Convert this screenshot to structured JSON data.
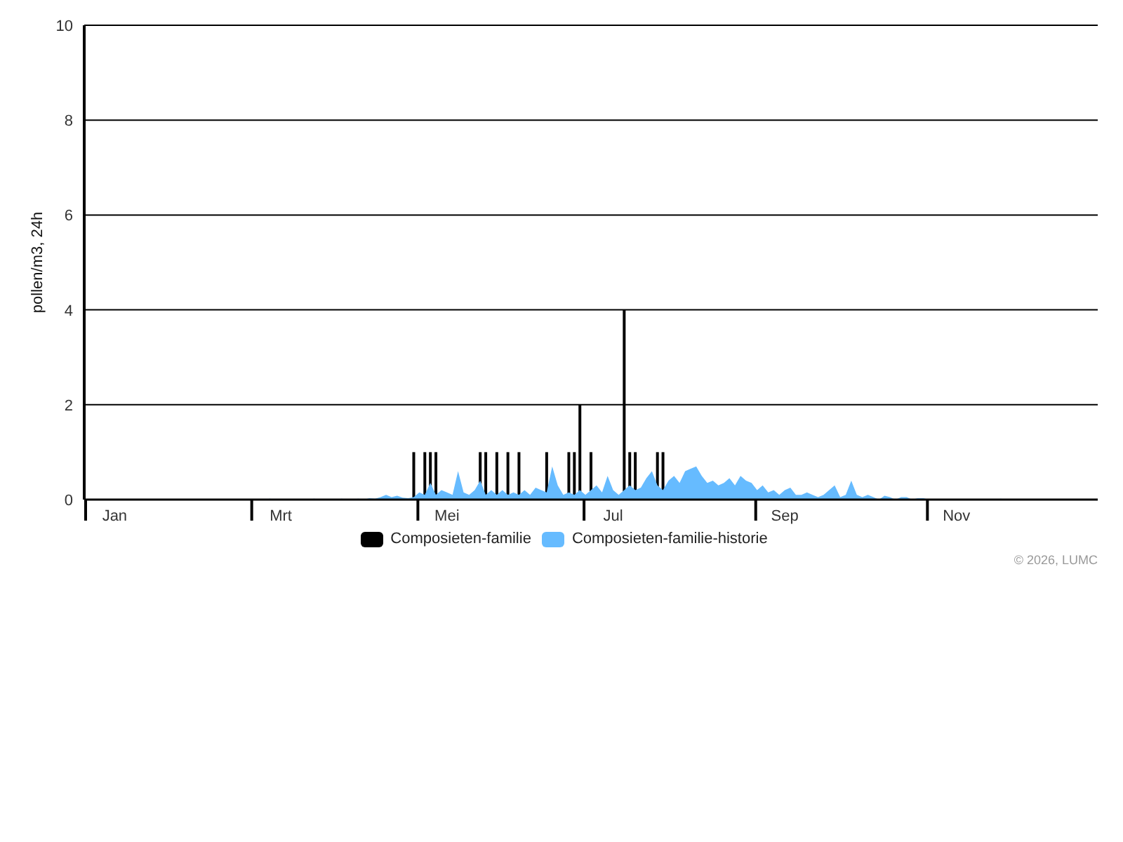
{
  "chart_data": {
    "type": "area",
    "ylabel": "pollen/m3, 24h",
    "categories": [
      null,
      null,
      null,
      null,
      null,
      "Jan",
      null,
      null,
      null,
      null,
      null,
      null,
      null,
      null,
      null,
      null,
      null,
      null,
      null,
      null,
      null,
      null,
      null,
      null,
      null,
      null,
      null,
      null,
      null,
      null,
      null,
      null,
      null,
      null,
      null,
      "Mrt",
      null,
      null,
      null,
      null,
      null,
      null,
      null,
      null,
      null,
      null,
      null,
      null,
      null,
      null,
      null,
      null,
      null,
      null,
      null,
      null,
      null,
      null,
      null,
      null,
      null,
      null,
      null,
      null,
      null,
      "Mei",
      null,
      null,
      null,
      null,
      null,
      null,
      null,
      null,
      null,
      null,
      null,
      null,
      null,
      null,
      null,
      null,
      null,
      null,
      null,
      null,
      null,
      null,
      null,
      null,
      null,
      null,
      null,
      null,
      null,
      "Jul",
      null,
      null,
      null,
      null,
      null,
      null,
      null,
      null,
      null,
      null,
      null,
      null,
      null,
      null,
      null,
      null,
      null,
      null,
      null,
      null,
      null,
      null,
      null,
      null,
      null,
      null,
      null,
      null,
      null,
      null,
      "Sep",
      null,
      null,
      null,
      null,
      null,
      null,
      null,
      null,
      null,
      null,
      null,
      null,
      null,
      null,
      null,
      null,
      null,
      null,
      null,
      null,
      null,
      null,
      null,
      null,
      null,
      null,
      null,
      null,
      null,
      null,
      "Nov",
      null,
      null,
      null,
      null,
      null,
      null,
      null,
      null,
      null,
      null,
      null,
      null,
      null,
      null,
      null,
      null,
      null,
      null,
      null,
      null,
      null,
      null,
      null,
      null,
      null
    ],
    "ylim": [
      0,
      10
    ],
    "grid": true,
    "legend": true,
    "yticks": [
      0,
      2,
      4,
      6,
      8,
      10
    ],
    "series": [
      {
        "name": "Composieten-familie",
        "type": "bar",
        "color": "#000000",
        "values": [
          0,
          0,
          0,
          0,
          0,
          0,
          0,
          0,
          0,
          0,
          0,
          0,
          0,
          0,
          0,
          0,
          0,
          0,
          0,
          0,
          0,
          0,
          0,
          0,
          0,
          0,
          0,
          0,
          0,
          0,
          0,
          0,
          0,
          0,
          0,
          0,
          0,
          0,
          0,
          0,
          0,
          0,
          0,
          0,
          0,
          0,
          0,
          0,
          0,
          0,
          0,
          0,
          0,
          0,
          0,
          0,
          0,
          0,
          0,
          1,
          0,
          1,
          1,
          1,
          0,
          0,
          0,
          0,
          0,
          0,
          0,
          1,
          1,
          0,
          1,
          0,
          1,
          0,
          1,
          0,
          0,
          0,
          0,
          1,
          0,
          0,
          0,
          1,
          1,
          2,
          0,
          1,
          0,
          0,
          0,
          0,
          0,
          4,
          1,
          1,
          0,
          0,
          0,
          1,
          1,
          0,
          0,
          0,
          0,
          0,
          0,
          0,
          0,
          0,
          0,
          0,
          0,
          0,
          0,
          0,
          0,
          0,
          0,
          0,
          0,
          0,
          0,
          0,
          0,
          0,
          0,
          0,
          0,
          0,
          0,
          0,
          0,
          0,
          0,
          0,
          0,
          0,
          0,
          0,
          0,
          0,
          0,
          0,
          0,
          0,
          0,
          0,
          0,
          0,
          0,
          0,
          0,
          0,
          0,
          0,
          0,
          0,
          0,
          0,
          0,
          0,
          0,
          0,
          0,
          0,
          0,
          0,
          0,
          0,
          0,
          0,
          0,
          0,
          0,
          0,
          0,
          0,
          0
        ]
      },
      {
        "name": "Composieten-familie-historie",
        "color": "#66bbff",
        "values": [
          0,
          0,
          0,
          0,
          0,
          0,
          0,
          0,
          0,
          0,
          0,
          0,
          0,
          0,
          0,
          0,
          0,
          0,
          0,
          0,
          0,
          0,
          0,
          0,
          0,
          0,
          0,
          0,
          0,
          0,
          0,
          0,
          0,
          0.02,
          0,
          0,
          0,
          0,
          0,
          0,
          0,
          0.02,
          0,
          0,
          0,
          0,
          0.02,
          0,
          0,
          0.02,
          0,
          0.03,
          0.02,
          0.05,
          0.1,
          0.05,
          0.08,
          0.04,
          0.03,
          0.05,
          0.15,
          0.1,
          0.35,
          0.1,
          0.2,
          0.15,
          0.1,
          0.6,
          0.15,
          0.1,
          0.2,
          0.4,
          0.1,
          0.2,
          0.1,
          0.2,
          0.1,
          0.15,
          0.1,
          0.2,
          0.1,
          0.25,
          0.2,
          0.15,
          0.7,
          0.3,
          0.1,
          0.15,
          0.1,
          0.2,
          0.1,
          0.2,
          0.3,
          0.15,
          0.5,
          0.2,
          0.1,
          0.2,
          0.3,
          0.2,
          0.25,
          0.45,
          0.6,
          0.3,
          0.2,
          0.4,
          0.5,
          0.35,
          0.6,
          0.65,
          0.7,
          0.5,
          0.35,
          0.4,
          0.3,
          0.35,
          0.45,
          0.3,
          0.5,
          0.4,
          0.35,
          0.2,
          0.3,
          0.15,
          0.2,
          0.1,
          0.2,
          0.25,
          0.1,
          0.1,
          0.15,
          0.1,
          0.05,
          0.1,
          0.2,
          0.3,
          0.05,
          0.1,
          0.4,
          0.1,
          0.05,
          0.1,
          0.05,
          0,
          0.08,
          0.05,
          0,
          0.05,
          0.05,
          0,
          0.03,
          0.03,
          0,
          0,
          0,
          0,
          0,
          0,
          0,
          0,
          0,
          0,
          0,
          0,
          0,
          0.02,
          0,
          0,
          0,
          0,
          0,
          0,
          0,
          0,
          0,
          0,
          0,
          0,
          0,
          0,
          0,
          0,
          0
        ]
      }
    ]
  },
  "copyright": "© 2026, LUMC"
}
